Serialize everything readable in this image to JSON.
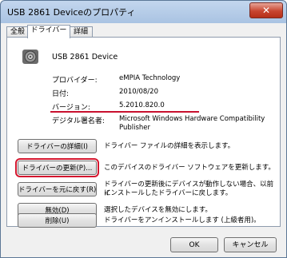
{
  "window": {
    "title": "USB 2861 Deviceのプロパティ",
    "close_glyph": "✕"
  },
  "tabs": [
    {
      "label": "全般"
    },
    {
      "label": "ドライバー"
    },
    {
      "label": "詳細"
    }
  ],
  "device": {
    "name": "USB 2861 Device",
    "icon": "speaker-icon"
  },
  "info": {
    "provider_label": "プロバイダー:",
    "provider_value": "eMPIA Technology",
    "date_label": "日付:",
    "date_value": "2010/08/20",
    "version_label": "バージョン:",
    "version_value": "5.2010.820.0",
    "signer_label": "デジタル署名者:",
    "signer_value_line1": "Microsoft Windows Hardware Compatibility",
    "signer_value_line2": "Publisher"
  },
  "actions": [
    {
      "button": "ドライバーの詳細(I)",
      "description": "ドライバー ファイルの詳細を表示します。"
    },
    {
      "button": "ドライバーの更新(P)...",
      "description": "このデバイスのドライバー ソフトウェアを更新します。"
    },
    {
      "button": "ドライバーを元に戻す(R)",
      "description_line1": "ドライバーの更新後にデバイスが動作しない場合、以前に",
      "description_line2": "インストールしたドライバーに戻します。"
    },
    {
      "button": "無効(D)",
      "description": "選択したデバイスを無効にします。"
    },
    {
      "button": "削除(U)",
      "description": "ドライバーをアンインストールします (上級者用)。"
    }
  ],
  "footer": {
    "ok": "OK",
    "cancel": "キャンセル"
  },
  "colors": {
    "annotation_red": "#c8102e",
    "title_gradient_top": "#c3d6ee"
  }
}
